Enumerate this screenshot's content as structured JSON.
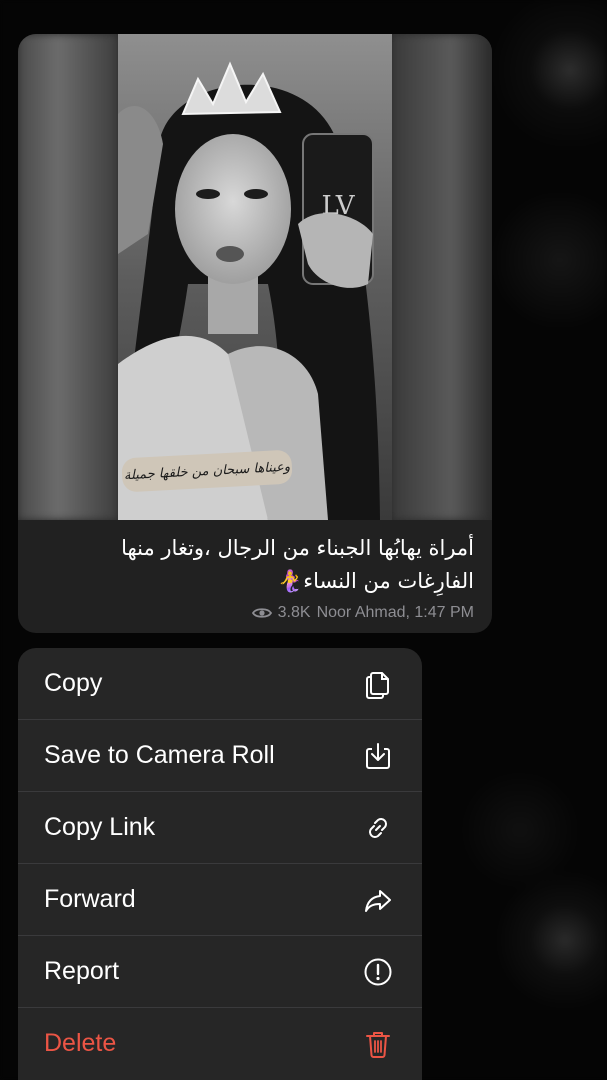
{
  "message": {
    "sticker_caption": "وعيناها سبحان من خلقها جميلة",
    "text_line1": "أمراة يهابُها الجبناء من الرجال ،وتغار منها",
    "text_line2": "الفارِغات من النساء🧜‍♀️",
    "views": "3.8K",
    "author_time": "Noor Ahmad, 1:47 PM",
    "view_icon": "eye-icon"
  },
  "menu": {
    "items": [
      {
        "label": "Copy",
        "icon": "copy-icon"
      },
      {
        "label": "Save to Camera Roll",
        "icon": "save-icon"
      },
      {
        "label": "Copy Link",
        "icon": "link-icon"
      },
      {
        "label": "Forward",
        "icon": "forward-icon"
      },
      {
        "label": "Report",
        "icon": "report-icon"
      },
      {
        "label": "Delete",
        "icon": "trash-icon"
      }
    ]
  },
  "colors": {
    "menu_bg": "#262626",
    "bubble_bg": "#212121",
    "danger": "#eb5545",
    "meta_text": "#8e8e93"
  }
}
